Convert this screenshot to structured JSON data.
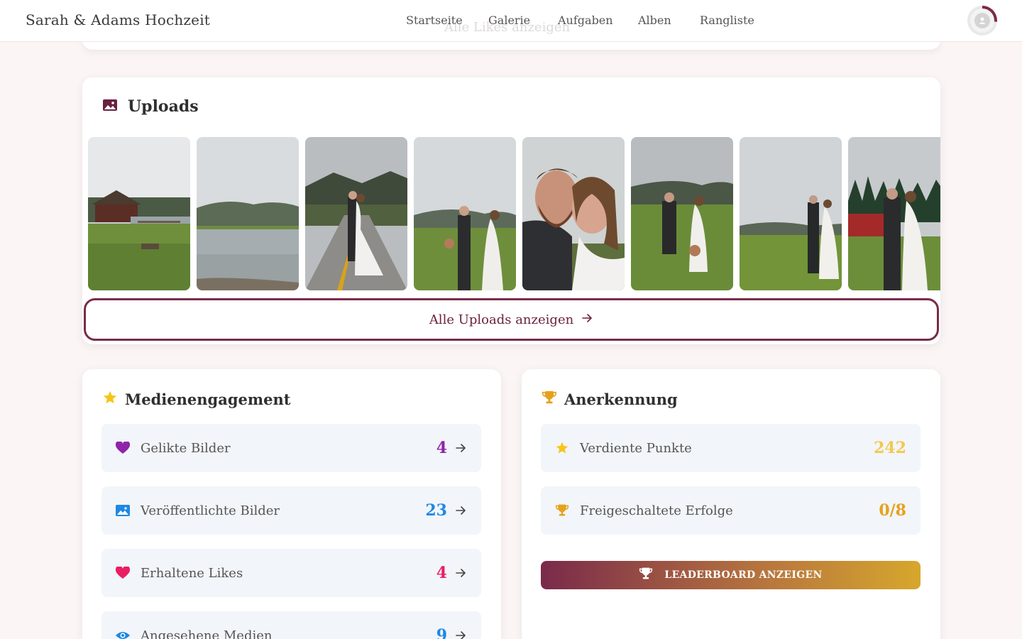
{
  "header": {
    "brand": "Sarah & Adams Hochzeit",
    "nav": [
      "Startseite",
      "Galerie",
      "Aufgaben",
      "Alben",
      "Rangliste"
    ],
    "ghost_text": "Alle Likes anzeigen"
  },
  "uploads": {
    "title": "Uploads",
    "button_label": "Alle Uploads anzeigen"
  },
  "engagement": {
    "title": "Medienengagement",
    "rows": [
      {
        "label": "Gelikte Bilder",
        "value": "4",
        "color": "#8e24aa",
        "icon": "heart-icon"
      },
      {
        "label": "Veröffentlichte Bilder",
        "value": "23",
        "color": "#1e88e5",
        "icon": "image-icon"
      },
      {
        "label": "Erhaltene Likes",
        "value": "4",
        "color": "#e91e63",
        "icon": "heart-icon"
      },
      {
        "label": "Angesehene Medien",
        "value": "9",
        "color": "#1e88e5",
        "icon": "eye-icon"
      }
    ]
  },
  "recognition": {
    "title": "Anerkennung",
    "rows": [
      {
        "label": "Verdiente Punkte",
        "value": "242",
        "color": "#f2c94c",
        "icon": "star-icon"
      },
      {
        "label": "Freigeschaltete Erfolge",
        "value": "0/8",
        "color": "#e6a11c",
        "icon": "trophy-icon"
      }
    ],
    "button_label": "LEADERBOARD ANZEIGEN"
  },
  "colors": {
    "accent": "#7a2a4a",
    "gold": "#d6a72c"
  }
}
